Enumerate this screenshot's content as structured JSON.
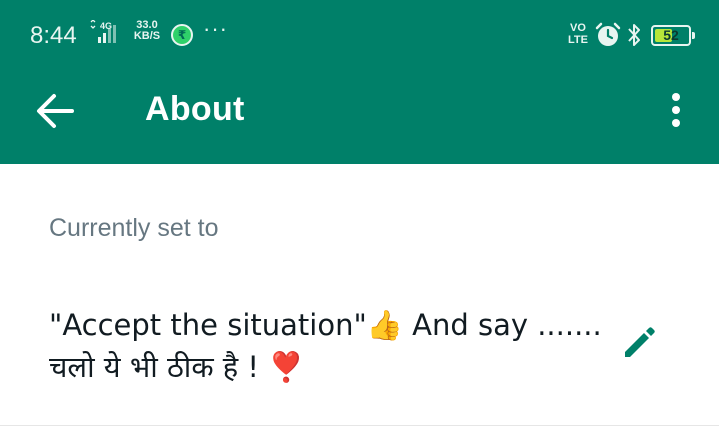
{
  "status_bar": {
    "time": "8:44",
    "network": "4G",
    "speed_value": "33.0",
    "speed_unit": "KB/S",
    "app_badge": "₹",
    "more": "···",
    "volte_top": "VO",
    "volte_bottom": "LTE",
    "battery": "52",
    "battery_level": 0.52,
    "icons": [
      "signal-icon",
      "payment-app-icon",
      "alarm-icon",
      "bluetooth-icon",
      "battery-icon"
    ]
  },
  "app_bar": {
    "title": "About",
    "background": "#008069",
    "back_icon": "arrow-left-icon",
    "menu_icon": "more-vertical-icon"
  },
  "about": {
    "label": "Currently set to",
    "text_line1": "\"Accept the situation\"👍 And say .......",
    "text_line2": "चलो ये भी ठीक है ! ❣️",
    "edit_icon": "pencil-icon",
    "accent": "#008069"
  }
}
